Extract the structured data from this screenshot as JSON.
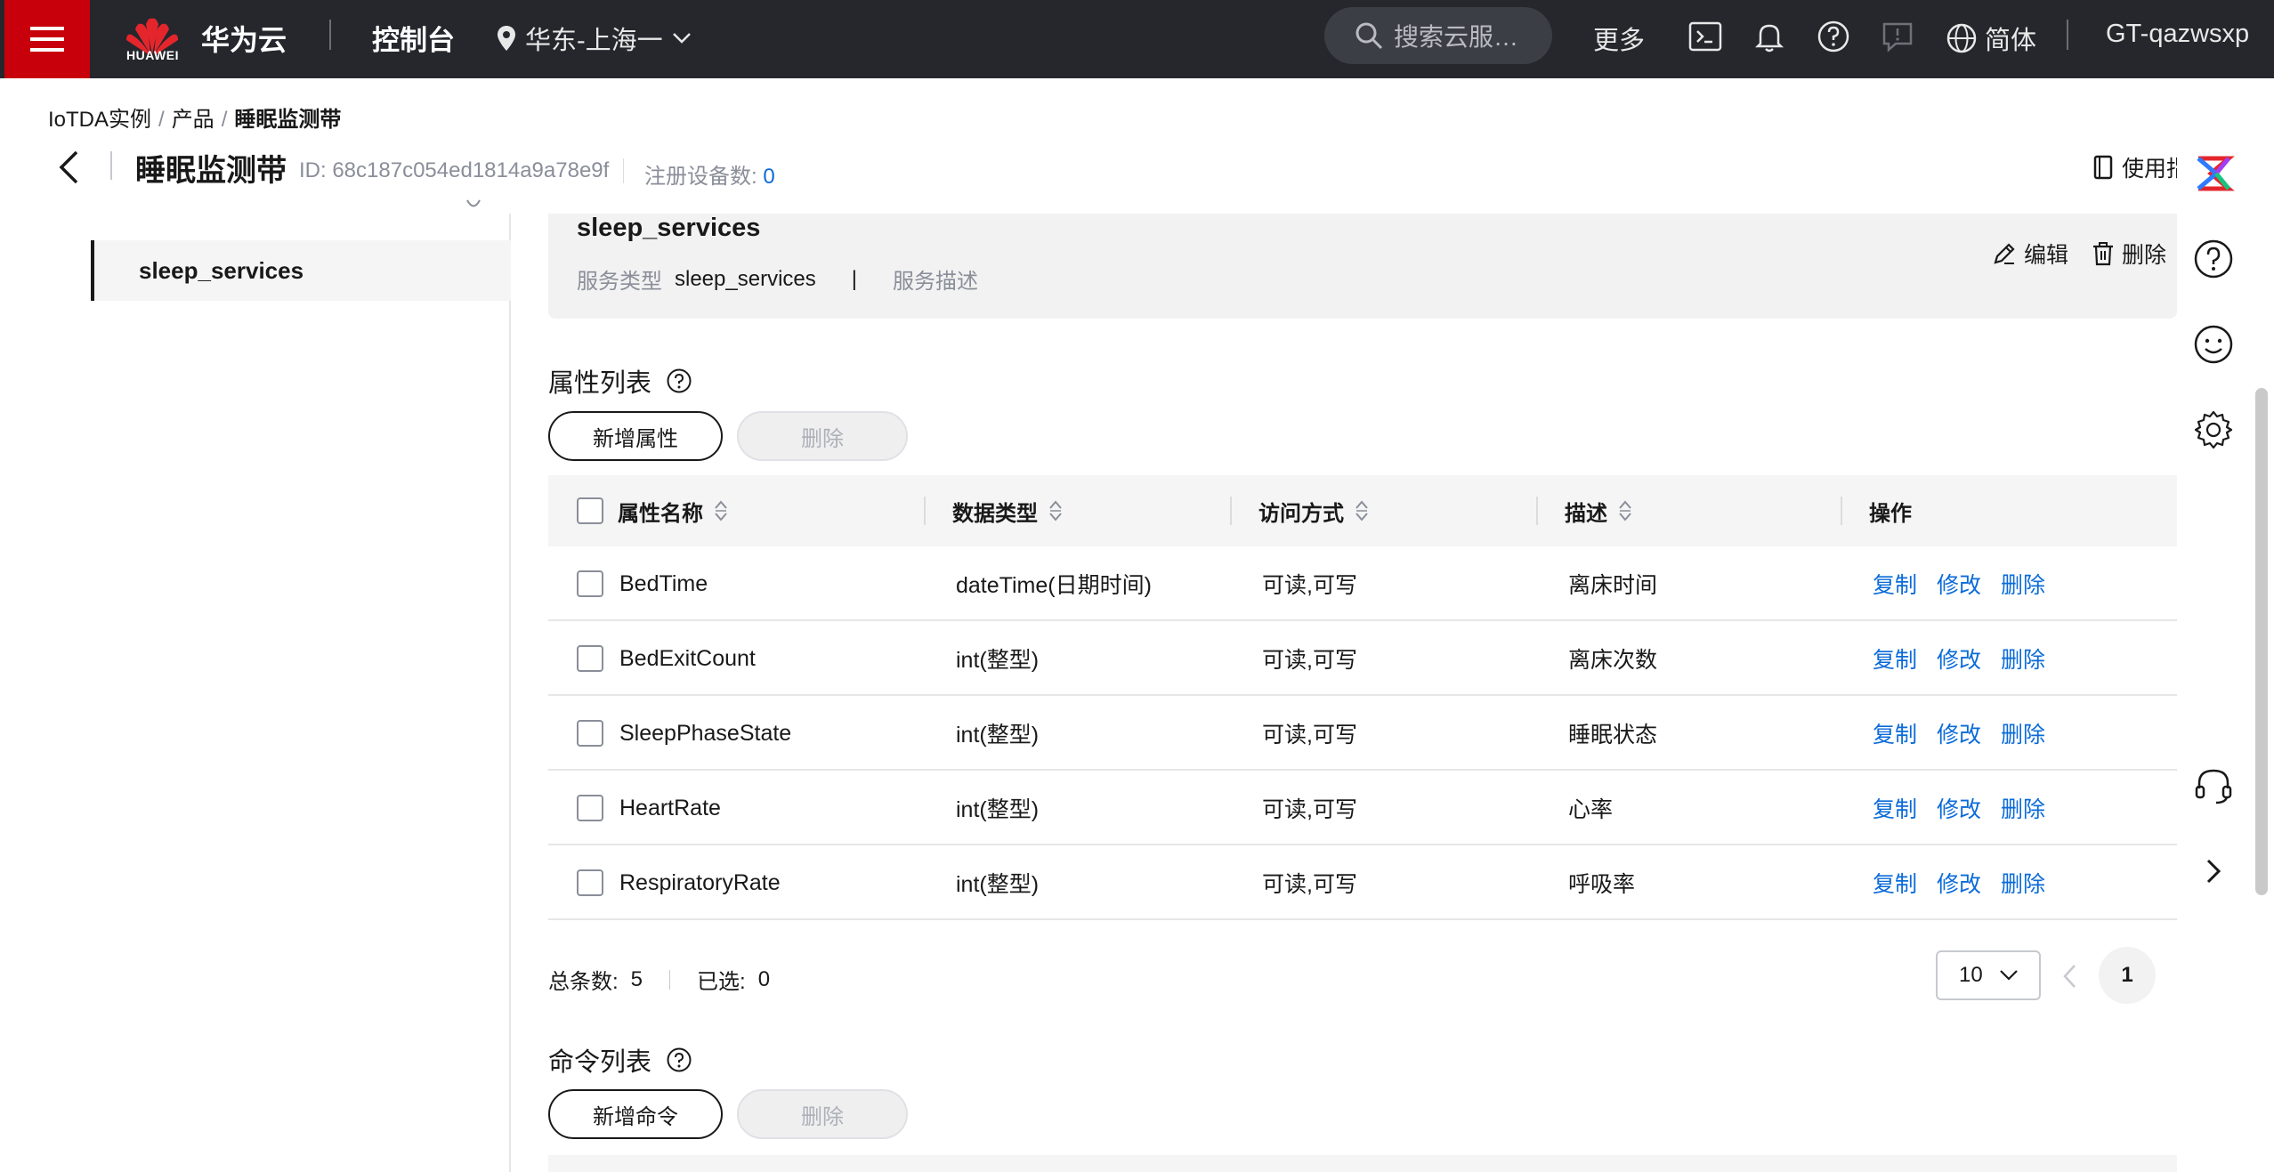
{
  "topbar": {
    "logo_text": "HUAWEI",
    "brand": "华为云",
    "console": "控制台",
    "region": "华东-上海一",
    "search_placeholder": "搜索云服…",
    "more": "更多",
    "language": "简体",
    "account": "GT-qazwsxp",
    "colors": {
      "background": "#25272d",
      "menu": "#c7000b"
    }
  },
  "breadcrumb": {
    "item1": "IoTDA实例",
    "sep": "/",
    "item2": "产品",
    "current": "睡眠监测带"
  },
  "header": {
    "title": "睡眠监测带",
    "id_label": "ID: 68c187c054ed1814a9a78e9f",
    "device_count_label": "注册设备数:",
    "device_count": "0",
    "usage_guide": "使用指"
  },
  "services": [
    {
      "name": "sleep_services"
    }
  ],
  "service_card": {
    "name": "sleep_services",
    "type_label": "服务类型",
    "type_value": "sleep_services",
    "divider": "|",
    "desc_label": "服务描述",
    "edit": "编辑",
    "delete": "删除"
  },
  "properties": {
    "title": "属性列表",
    "add_button": "新增属性",
    "delete_button": "删除",
    "columns": {
      "name": "属性名称",
      "type": "数据类型",
      "access": "访问方式",
      "desc": "描述",
      "ops": "操作"
    },
    "rows": [
      {
        "name": "BedTime",
        "type": "dateTime(日期时间)",
        "access": "可读,可写",
        "desc": "离床时间"
      },
      {
        "name": "BedExitCount",
        "type": "int(整型)",
        "access": "可读,可写",
        "desc": "离床次数"
      },
      {
        "name": "SleepPhaseState",
        "type": "int(整型)",
        "access": "可读,可写",
        "desc": "睡眠状态"
      },
      {
        "name": "HeartRate",
        "type": "int(整型)",
        "access": "可读,可写",
        "desc": "心率"
      },
      {
        "name": "RespiratoryRate",
        "type": "int(整型)",
        "access": "可读,可写",
        "desc": "呼吸率"
      }
    ],
    "row_actions": {
      "copy": "复制",
      "modify": "修改",
      "delete": "删除"
    },
    "link_color": "#0b6bd8"
  },
  "pagination": {
    "total_label": "总条数:",
    "total": "5",
    "selected_label": "已选:",
    "selected": "0",
    "page_size": "10",
    "current_page": "1"
  },
  "commands": {
    "title": "命令列表",
    "add_button": "新增命令",
    "delete_button": "删除"
  },
  "icons": {
    "topbar": [
      "menu-icon",
      "huawei-logo",
      "location-icon",
      "chevron-down-icon",
      "search-icon",
      "terminal-icon",
      "bell-icon",
      "help-icon",
      "feedback-icon",
      "globe-icon"
    ],
    "right_toolbar": [
      "codearts-icon",
      "help-icon",
      "smiley-icon",
      "gear-icon",
      "headset-icon",
      "chevron-right-icon"
    ]
  }
}
